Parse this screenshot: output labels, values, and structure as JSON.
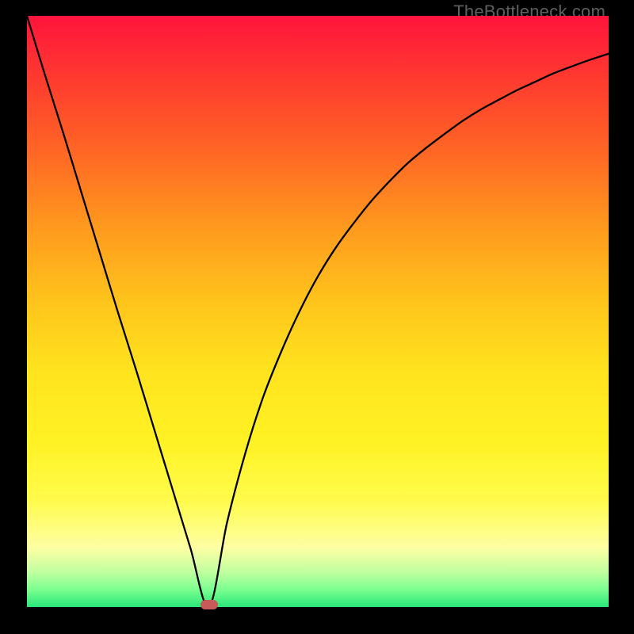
{
  "watermark": "TheBottleneck.com",
  "chart_data": {
    "type": "line",
    "title": "",
    "xlabel": "",
    "ylabel": "",
    "xlim": [
      0,
      1
    ],
    "ylim": [
      0,
      100
    ],
    "minimum_x": 0.313,
    "marker": {
      "x": 0.313,
      "y": 0
    },
    "x": [
      0.0,
      0.031,
      0.063,
      0.094,
      0.125,
      0.156,
      0.188,
      0.219,
      0.25,
      0.281,
      0.313,
      0.344,
      0.375,
      0.406,
      0.438,
      0.469,
      0.5,
      0.531,
      0.563,
      0.594,
      0.625,
      0.656,
      0.688,
      0.719,
      0.75,
      0.781,
      0.813,
      0.844,
      0.875,
      0.906,
      0.938,
      0.969,
      1.0
    ],
    "values": [
      100.0,
      90.0,
      80.0,
      70.0,
      60.0,
      50.0,
      40.0,
      30.0,
      20.0,
      10.0,
      0.0,
      14.3,
      25.9,
      35.5,
      43.4,
      50.1,
      55.9,
      60.8,
      65.1,
      68.9,
      72.2,
      75.2,
      77.8,
      80.1,
      82.3,
      84.2,
      85.9,
      87.5,
      88.9,
      90.3,
      91.5,
      92.6,
      93.6
    ]
  }
}
